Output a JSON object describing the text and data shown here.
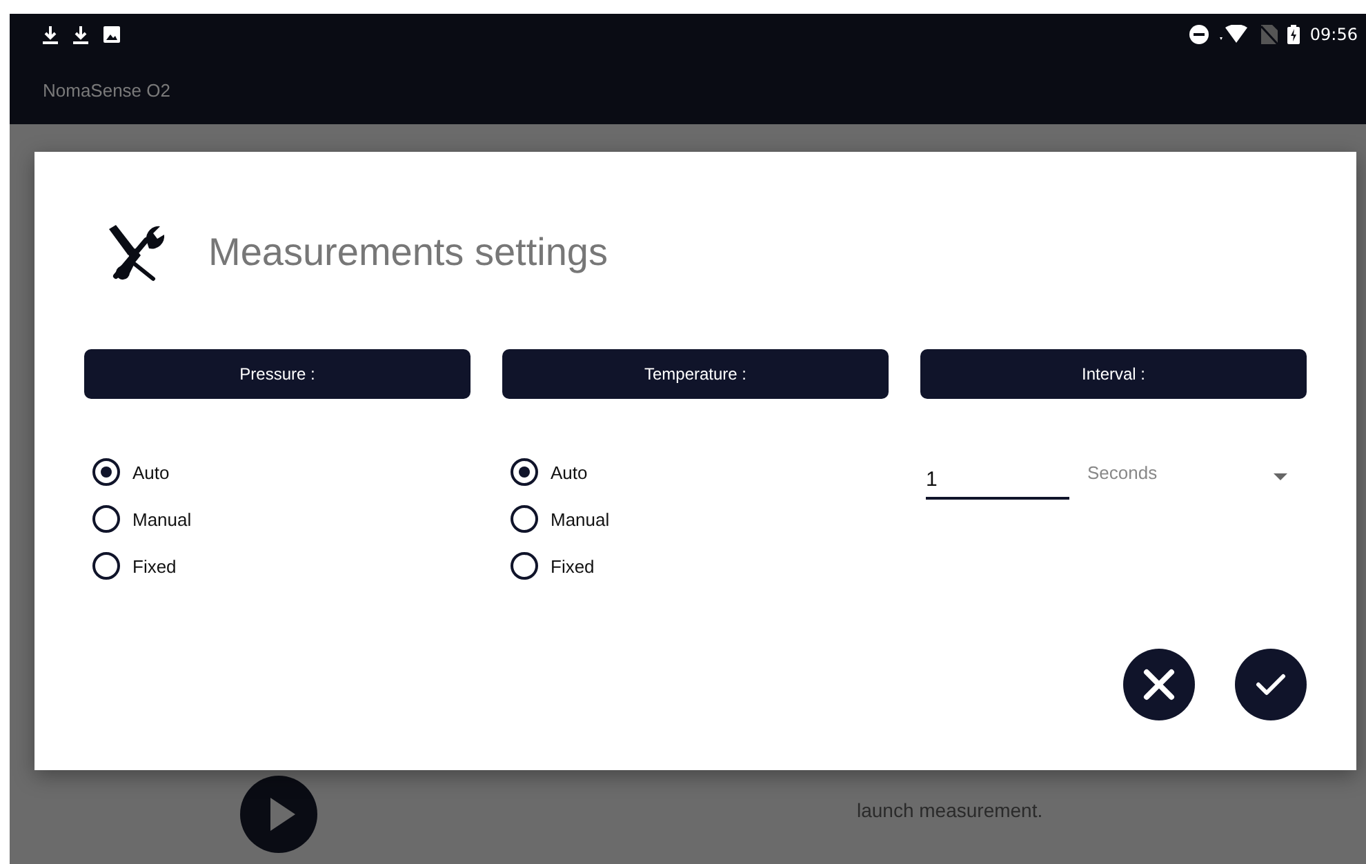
{
  "status_bar": {
    "time": "09:56"
  },
  "app_bar": {
    "title": "NomaSense O2"
  },
  "background": {
    "hint": "launch measurement."
  },
  "dialog": {
    "title": "Measurements settings",
    "columns": [
      {
        "kind": "radio",
        "header": "Pressure :",
        "options": [
          {
            "label": "Auto",
            "selected": true
          },
          {
            "label": "Manual",
            "selected": false
          },
          {
            "label": "Fixed",
            "selected": false
          }
        ]
      },
      {
        "kind": "radio",
        "header": "Temperature :",
        "options": [
          {
            "label": "Auto",
            "selected": true
          },
          {
            "label": "Manual",
            "selected": false
          },
          {
            "label": "Fixed",
            "selected": false
          }
        ]
      },
      {
        "kind": "interval",
        "header": "Interval :",
        "value": "1",
        "unit": "Seconds"
      }
    ]
  }
}
